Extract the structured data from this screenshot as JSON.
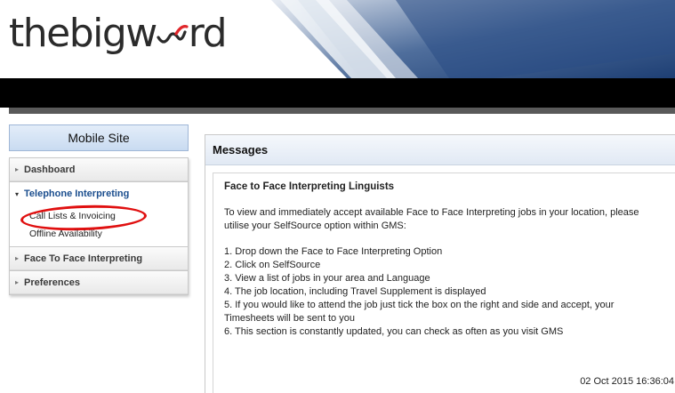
{
  "header": {
    "logo_prefix": "thebigw",
    "logo_suffix": "rd"
  },
  "sidebar": {
    "mobile_site_label": "Mobile Site",
    "sections": [
      {
        "label": "Dashboard",
        "expanded": false
      },
      {
        "label": "Telephone Interpreting",
        "expanded": true,
        "items": [
          {
            "label": "Call Lists & Invoicing",
            "highlighted": true
          },
          {
            "label": "Offline Availability",
            "highlighted": false
          }
        ]
      },
      {
        "label": "Face To Face Interpreting",
        "expanded": false
      },
      {
        "label": "Preferences",
        "expanded": false
      }
    ]
  },
  "messages": {
    "panel_title": "Messages",
    "title": "Face to Face Interpreting Linguists",
    "intro_line1": "To view and immediately accept available Face to Face Interpreting jobs in your location, please",
    "intro_line2": "utilise your SelfSource option within GMS:",
    "steps": [
      "1. Drop down the Face to Face Interpreting Option",
      "2. Click on SelfSource",
      "3. View a list of jobs in your area and Language",
      "4. The job location, including Travel Supplement is displayed",
      "5. If you would like to attend the job just tick the box on the right and side and accept, your",
      "Timesheets will be sent to you",
      "6. This section is constantly updated, you can check as often as you visit GMS"
    ],
    "date": "02 Oct 2015 16:36:04"
  },
  "colors": {
    "accent_blue": "#1b4e8e",
    "highlight_red": "#e01010"
  }
}
